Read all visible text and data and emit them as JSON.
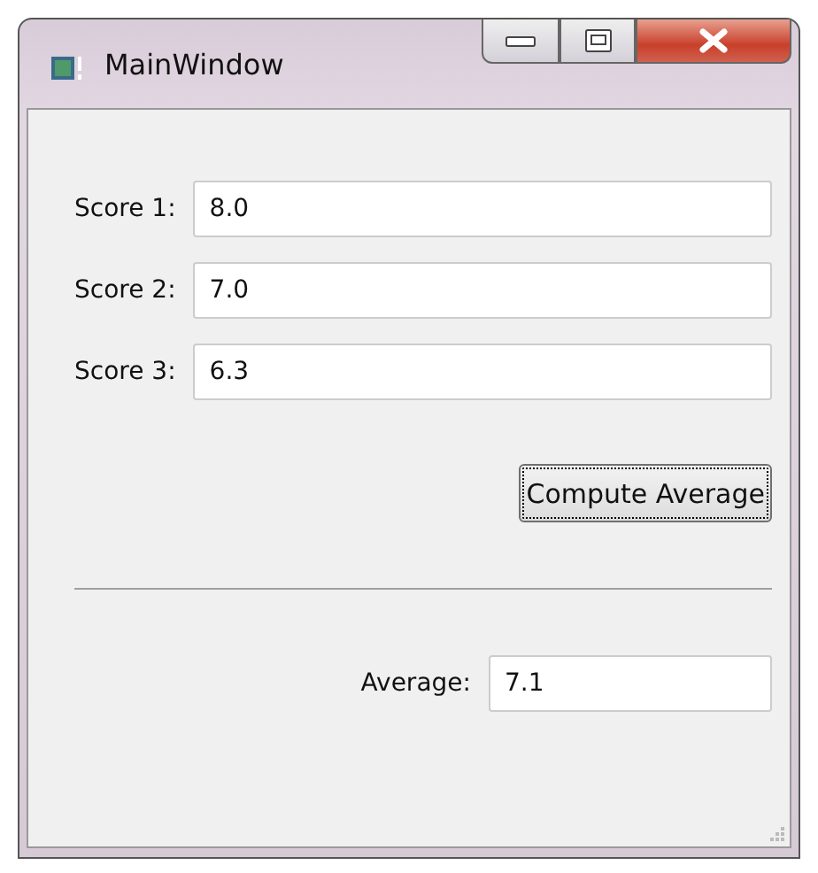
{
  "window": {
    "title": "MainWindow"
  },
  "scores": [
    {
      "label": "Score 1:",
      "value": "8.0"
    },
    {
      "label": "Score 2:",
      "value": "7.0"
    },
    {
      "label": "Score 3:",
      "value": "6.3"
    }
  ],
  "compute_button": {
    "label": "Compute Average",
    "focused": true
  },
  "result": {
    "label": "Average:",
    "value": "7.1"
  }
}
